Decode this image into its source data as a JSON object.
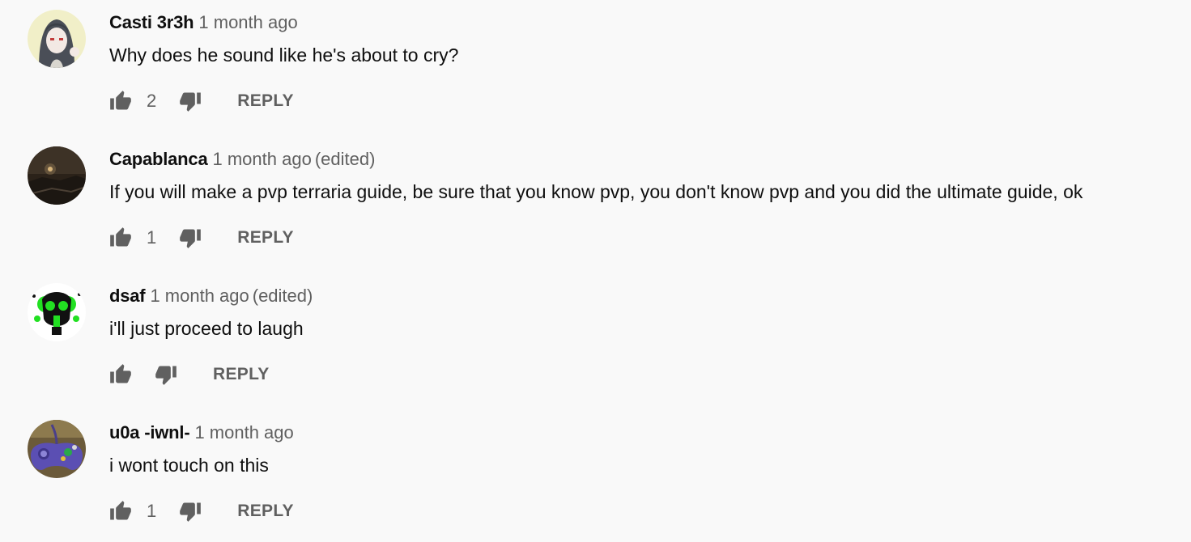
{
  "comments": [
    {
      "author": "Casti 3r3h",
      "time": "1 month ago",
      "edited": "",
      "text": "Why does he sound like he's about to cry?",
      "likes": "2",
      "reply_label": "REPLY",
      "avatar_icon": "anime-girl-avatar"
    },
    {
      "author": "Capablanca",
      "time": "1 month ago",
      "edited": "(edited)",
      "text": "If you will make a pvp terraria guide, be sure that you know pvp, you don't know pvp and you did the ultimate guide, ok",
      "likes": "1",
      "reply_label": "REPLY",
      "avatar_icon": "night-landscape-avatar"
    },
    {
      "author": "dsaf",
      "time": "1 month ago",
      "edited": "(edited)",
      "text": "i'll just proceed to laugh",
      "likes": "",
      "reply_label": "REPLY",
      "avatar_icon": "gas-mask-avatar"
    },
    {
      "author": "u0a -iwnl-",
      "time": "1 month ago",
      "edited": "",
      "text": "i wont touch on this",
      "likes": "1",
      "reply_label": "REPLY",
      "avatar_icon": "gamecube-controller-avatar"
    }
  ],
  "colors": {
    "background": "#f9f9f9",
    "text": "#0f0f0f",
    "secondary": "#606060"
  },
  "icons": {
    "like": "thumbs-up-icon",
    "dislike": "thumbs-down-icon"
  }
}
